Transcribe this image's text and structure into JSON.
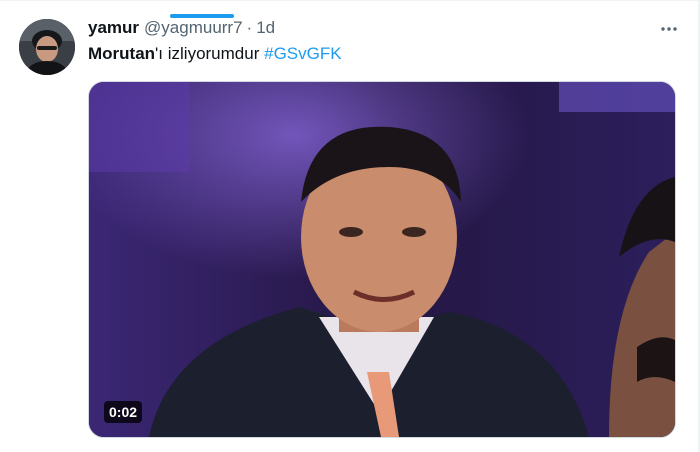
{
  "tweet": {
    "display_name": "yamur",
    "handle": "@yagmuurr7",
    "separator": "·",
    "time": "1d",
    "more_icon": "more-horizontal-icon",
    "text_bold": "Morutan",
    "text_plain": "'ı izliyorumdur ",
    "hashtag": "#GSvGFK"
  },
  "media": {
    "type": "video",
    "duration": "0:02"
  },
  "colors": {
    "accent": "#1d9bf0",
    "text_primary": "#0f1419",
    "text_secondary": "#536471"
  }
}
